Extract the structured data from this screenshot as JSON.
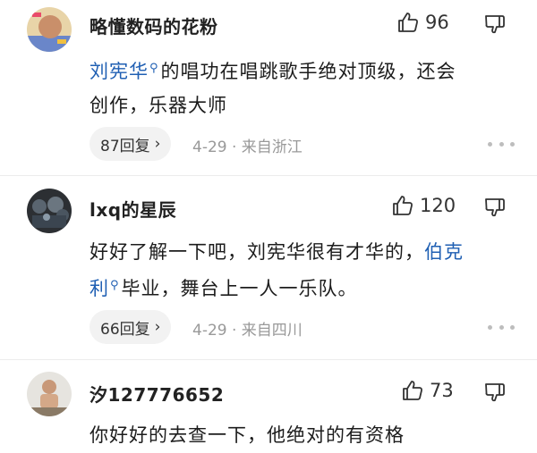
{
  "comments": [
    {
      "username": "略懂数码的花粉",
      "likes": "96",
      "text_link1": "刘宪华",
      "text_a": "的唱功在唱跳歌手绝对顶级，还会",
      "text_b": "创作，乐器大师",
      "reply_label": "87回复",
      "meta": "4-29 · 来自浙江",
      "avatar_icon": "avatar-icon"
    },
    {
      "username": "lxq的星辰",
      "likes": "120",
      "text_a": "好好了解一下吧，刘宪华很有才华的，",
      "text_link1": "伯克",
      "text_link2": "利",
      "text_b": "毕业，舞台上一人一乐队。",
      "reply_label": "66回复",
      "meta": "4-29 · 来自四川",
      "avatar_icon": "avatar-icon"
    },
    {
      "username": "汐127776652",
      "likes": "73",
      "text_a": "你好好的去查一下，他绝对的有资格",
      "avatar_icon": "avatar-icon"
    }
  ],
  "icons": {
    "like": "thumbs-up-icon",
    "dislike": "thumbs-down-icon",
    "search_mark": "search-icon",
    "more": "more-icon",
    "reply_chevron": "chevron-right-icon"
  },
  "colors": {
    "link": "#1f5fb3",
    "meta": "#999999",
    "pill_bg": "#f2f2f2"
  }
}
